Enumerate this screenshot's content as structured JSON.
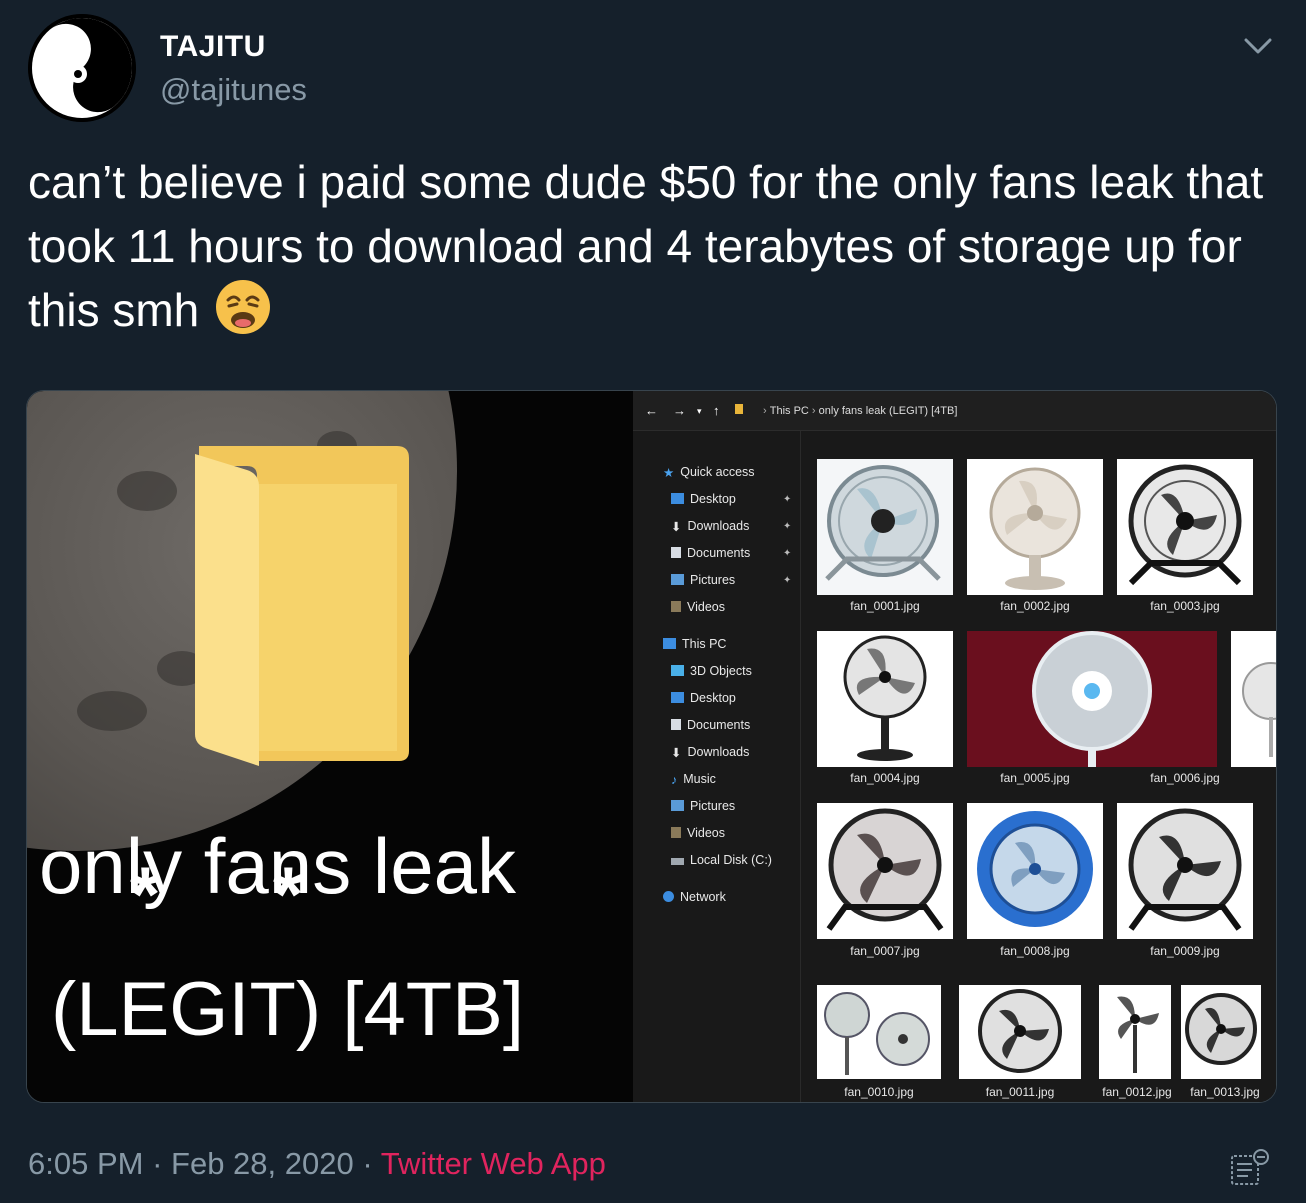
{
  "tweet": {
    "author_name": "TAJITU",
    "author_handle": "@tajitunes",
    "text": "can’t believe i paid some dude $50 for the only fans leak that took 11 hours to download and 4 terabytes of storage up for this smh",
    "emoji": "weary-face",
    "time": "6:05 PM",
    "date": "Feb 28, 2020",
    "source": "Twitter Web App",
    "separator": " · "
  },
  "media": {
    "folder_title": "only fans leak",
    "folder_subtitle": "(LEGIT) [4TB]",
    "asterisk": "*",
    "explorer": {
      "path_root": "This PC",
      "path_folder": "only fans leak (LEGIT) [4TB]",
      "sidebar": [
        {
          "label": "Quick access",
          "icon": "star-icon",
          "pinned": false
        },
        {
          "label": "Desktop",
          "icon": "desktop-icon",
          "pinned": true
        },
        {
          "label": "Downloads",
          "icon": "download-icon",
          "pinned": true
        },
        {
          "label": "Documents",
          "icon": "document-icon",
          "pinned": true
        },
        {
          "label": "Pictures",
          "icon": "pictures-icon",
          "pinned": true
        },
        {
          "label": "Videos",
          "icon": "video-icon",
          "pinned": false
        },
        {
          "label": "This PC",
          "icon": "computer-icon",
          "pinned": false
        },
        {
          "label": "3D Objects",
          "icon": "cube-icon",
          "pinned": false
        },
        {
          "label": "Desktop",
          "icon": "desktop-icon",
          "pinned": false
        },
        {
          "label": "Documents",
          "icon": "document-icon",
          "pinned": false
        },
        {
          "label": "Downloads",
          "icon": "download-icon",
          "pinned": false
        },
        {
          "label": "Music",
          "icon": "music-icon",
          "pinned": false
        },
        {
          "label": "Pictures",
          "icon": "pictures-icon",
          "pinned": false
        },
        {
          "label": "Videos",
          "icon": "video-icon",
          "pinned": false
        },
        {
          "label": "Local Disk (C:)",
          "icon": "disk-icon",
          "pinned": false
        },
        {
          "label": "Network",
          "icon": "network-icon",
          "pinned": false
        }
      ],
      "files": [
        "fan_0001.jpg",
        "fan_0002.jpg",
        "fan_0003.jpg",
        "fan_0004.jpg",
        "fan_0005.jpg",
        "fan_0006.jpg",
        "fan_0007.jpg",
        "fan_0008.jpg",
        "fan_0009.jpg",
        "fan_0010.jpg",
        "fan_0011.jpg",
        "fan_0012.jpg",
        "fan_0013.jpg"
      ]
    }
  },
  "colors": {
    "background": "#15202b",
    "secondary_text": "#8899a6",
    "source_link": "#e0245e",
    "folder": "#f6d36b"
  }
}
